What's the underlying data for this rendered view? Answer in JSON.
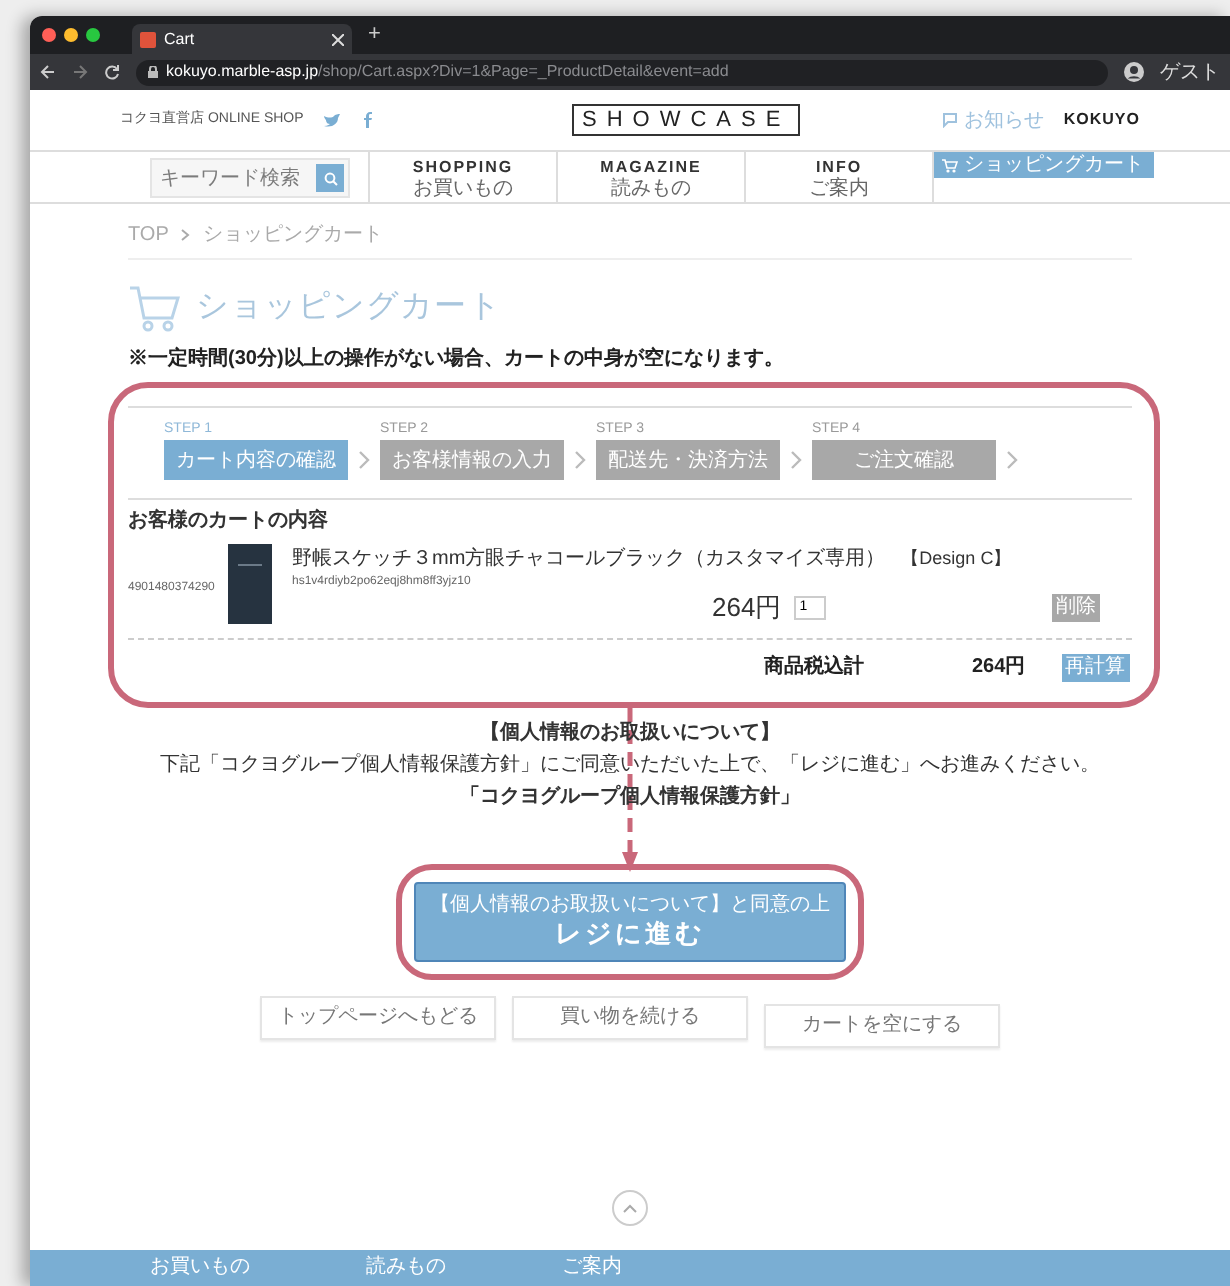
{
  "browser": {
    "tab_title": "Cart",
    "new_tab": "+",
    "url_host": "kokuyo.marble-asp.jp",
    "url_path": "/shop/Cart.aspx?Div=1&Page=_ProductDetail&event=add",
    "profile": "ゲスト"
  },
  "header": {
    "shop_label": "コクヨ直営店 ONLINE SHOP",
    "logo": "SHOWCASE",
    "news": "お知らせ",
    "brand": "KOKUYO"
  },
  "nav": {
    "search": {
      "placeholder": "キーワード検索"
    },
    "items": [
      {
        "label": "SHOPPING",
        "sub": "お買いもの"
      },
      {
        "label": "MAGAZINE",
        "sub": "読みもの"
      },
      {
        "label": "INFO",
        "sub": "ご案内"
      }
    ],
    "cart_button": "ショッピングカート"
  },
  "breadcrumb": [
    "TOP",
    "ショッピングカート"
  ],
  "title": "ショッピングカート",
  "notice": "※一定時間(30分)以上の操作がない場合、カートの中身が空になります。",
  "steps": [
    {
      "step": "STEP 1",
      "label": "カート内容の確認",
      "selected": true
    },
    {
      "step": "STEP 2",
      "label": "お客様情報の入力",
      "selected": false
    },
    {
      "step": "STEP 3",
      "label": "配送先・決済方法",
      "selected": false
    },
    {
      "step": "STEP 4",
      "label": "ご注文確認",
      "selected": false
    }
  ],
  "cart": {
    "heading": "お客様のカートの内容",
    "items": [
      {
        "code": "4901480374290",
        "name": "野帳スケッチ３mm方眼チャコールブラック（カスタマイズ専用）",
        "variant": "【Design C】",
        "option": "hs1v4rdiyb2po62eqj8hm8ff3yjz10",
        "price": "264円",
        "quantity": "1",
        "delete": "削除"
      }
    ],
    "total_label": "商品税込計",
    "total": "264円",
    "recalc": "再計算"
  },
  "privacy": {
    "heading": "【個人情報のお取扱いについて】",
    "text": "下記「コクヨグループ個人情報保護方針」にご同意いただいた上で、「レジに進む」へお進みください。",
    "link": "「コクヨグループ個人情報保護方針」"
  },
  "checkout": {
    "note": "【個人情報のお取扱いについて】と同意の上",
    "label": "レジに進む"
  },
  "buttons": [
    "トップページへもどる",
    "買い物を続ける",
    "カートを空にする"
  ],
  "footer": [
    "お買いもの",
    "読みもの",
    "ご案内"
  ]
}
